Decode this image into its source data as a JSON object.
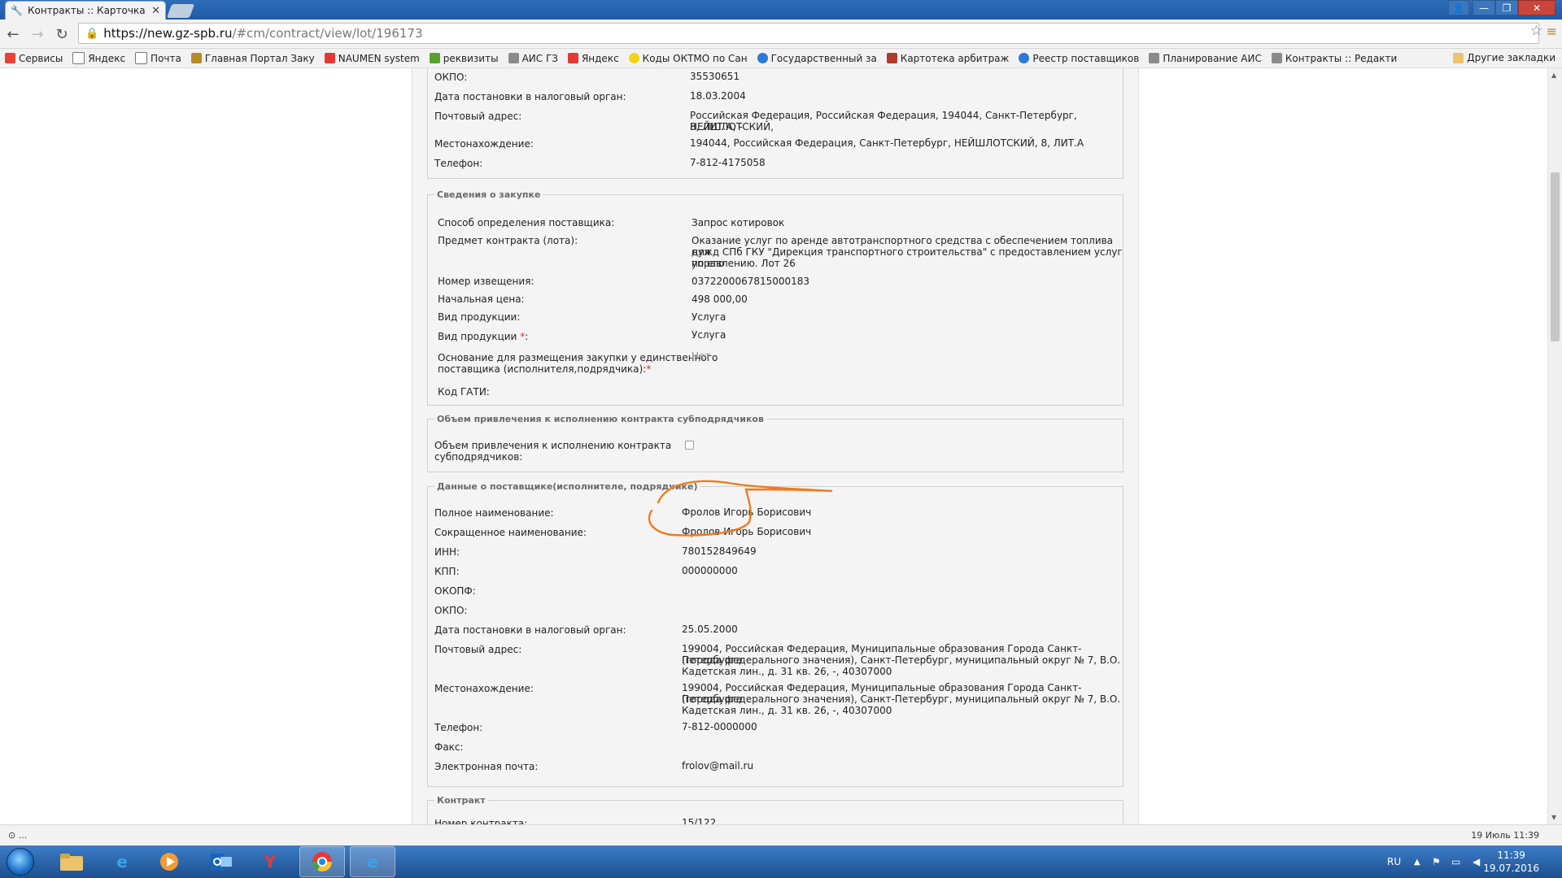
{
  "browser": {
    "tab_title": "Контракты :: Карточка ко",
    "tab_close": "✕",
    "url_host": "https://new.gz-spb.ru",
    "url_path": "/#cm/contract/view/lot/196173"
  },
  "bookmarks": [
    {
      "label": "Сервисы",
      "icon": "apps-icon",
      "color": "#e94235"
    },
    {
      "label": "Яндекс",
      "icon": "page-icon",
      "color": "#ffffff"
    },
    {
      "label": "Почта",
      "icon": "page-icon",
      "color": "#ffffff"
    },
    {
      "label": "Главная Портал Заку",
      "icon": "emblem-icon",
      "color": "#b58b2a"
    },
    {
      "label": "NAUMEN system",
      "icon": "yandex-icon",
      "color": "#e53935"
    },
    {
      "label": "реквизиты",
      "icon": "map-icon",
      "color": "#5aa02c"
    },
    {
      "label": "АИС ГЗ",
      "icon": "tools-icon",
      "color": "#8a8a8a"
    },
    {
      "label": "Яндекс",
      "icon": "yandex-icon",
      "color": "#e53935"
    },
    {
      "label": "Коды ОКТМО по Сан",
      "icon": "circle-icon",
      "color": "#f5d40f"
    },
    {
      "label": "Государственный за",
      "icon": "globe-icon",
      "color": "#2a7bd6"
    },
    {
      "label": "Картотека арбитраж",
      "icon": "emblem-icon",
      "color": "#b03a2e"
    },
    {
      "label": "Реестр поставщиков",
      "icon": "globe-icon",
      "color": "#2a7bd6"
    },
    {
      "label": "Планирование АИС",
      "icon": "tools-icon",
      "color": "#8a8a8a"
    },
    {
      "label": "Контракты :: Редакти",
      "icon": "tools-icon",
      "color": "#8a8a8a"
    }
  ],
  "bookmarks_other": "Другие закладки",
  "customer_tail": {
    "okpo_label": "ОКПО:",
    "okpo_value": "35530651",
    "tax_date_label": "Дата постановки в налоговый орган:",
    "tax_date_value": "18.03.2004",
    "postal_label": "Почтовый адрес:",
    "postal_line1": "Российская Федерация, Российская Федерация, 194044, Санкт-Петербург, НЕЙШЛОТСКИЙ,",
    "postal_line2": "8, ЛИТ.А, -",
    "location_label": "Местонахождение:",
    "location_value": "194044, Российская Федерация, Санкт-Петербург, НЕЙШЛОТСКИЙ, 8, ЛИТ.А",
    "phone_label": "Телефон:",
    "phone_value": "7-812-4175058"
  },
  "purchase": {
    "legend": "Сведения о закупке",
    "method_label": "Способ определения поставщика:",
    "method_value": "Запрос котировок",
    "subject_label": "Предмет контракта (лота):",
    "subject_line1": "Оказание услуг по аренде автотранспортного средства с обеспечением топлива для",
    "subject_line2": "нужд СПб ГКУ \"Дирекция транспортного строительства\" с предоставлением услуг по его",
    "subject_line3": "управлению. Лот 26",
    "notice_label": "Номер извещения:",
    "notice_value": "0372200067815000183",
    "price_label": "Начальная цена:",
    "price_value": "498 000,00",
    "product_label": "Вид продукции:",
    "product_value": "Услуга",
    "product2_label": "Вид продукции",
    "product2_value": "Услуга",
    "required_mark": "*",
    "colon": ":",
    "single_label_line1": "Основание для размещения закупки у единственного",
    "single_label_line2": "поставщика (исполнителя,подрядчика):",
    "single_value": "Нет",
    "gati_label": "Код ГАТИ:"
  },
  "subcontract": {
    "legend": "Объем привлечения к исполнению контракта субподрядчиков",
    "label_line1": "Объем привлечения к исполнению контракта",
    "label_line2": "субподрядчиков:",
    "checked": false
  },
  "supplier": {
    "legend": "Данные о поставщике(исполнителе, подрядчике)",
    "full_name_label": "Полное наименование:",
    "full_name_value": "Фролов Игорь Борисович",
    "short_name_label": "Сокращенное наименование:",
    "short_name_value": "Фролов Игорь Борисович",
    "inn_label": "ИНН:",
    "inn_value": "780152849649",
    "kpp_label": "КПП:",
    "kpp_value": "000000000",
    "okopf_label": "ОКОПФ:",
    "okpo_label": "ОКПО:",
    "tax_date_label": "Дата постановки в налоговый орган:",
    "tax_date_value": "25.05.2000",
    "postal_label": "Почтовый адрес:",
    "postal_line1": "199004, Российская Федерация, Муниципальные образования Города Санкт-Петербурга",
    "postal_line2": "(города федерального значения), Санкт-Петербург, муниципальный округ № 7, В.О.",
    "postal_line3": "Кадетская лин., д. 31 кв. 26, -, 40307000",
    "location_label": "Местонахождение:",
    "location_line1": "199004, Российская Федерация, Муниципальные образования Города Санкт-Петербурга",
    "location_line2": "(города федерального значения), Санкт-Петербург, муниципальный округ № 7, В.О.",
    "location_line3": "Кадетская лин., д. 31 кв. 26, -, 40307000",
    "phone_label": "Телефон:",
    "phone_value": "7-812-0000000",
    "fax_label": "Факс:",
    "email_label": "Электронная почта:",
    "email_value": "frolov@mail.ru",
    "highlight_color": "#f07b1e"
  },
  "contract": {
    "legend": "Контракт",
    "number_label": "Номер контракта:",
    "number_value": "15/122"
  },
  "statusbar": {
    "left": "⊙ ...",
    "right": "19 Июль 11:39"
  },
  "taskbar": {
    "lang": "RU",
    "time": "11:39",
    "date": "19.07.2016"
  }
}
